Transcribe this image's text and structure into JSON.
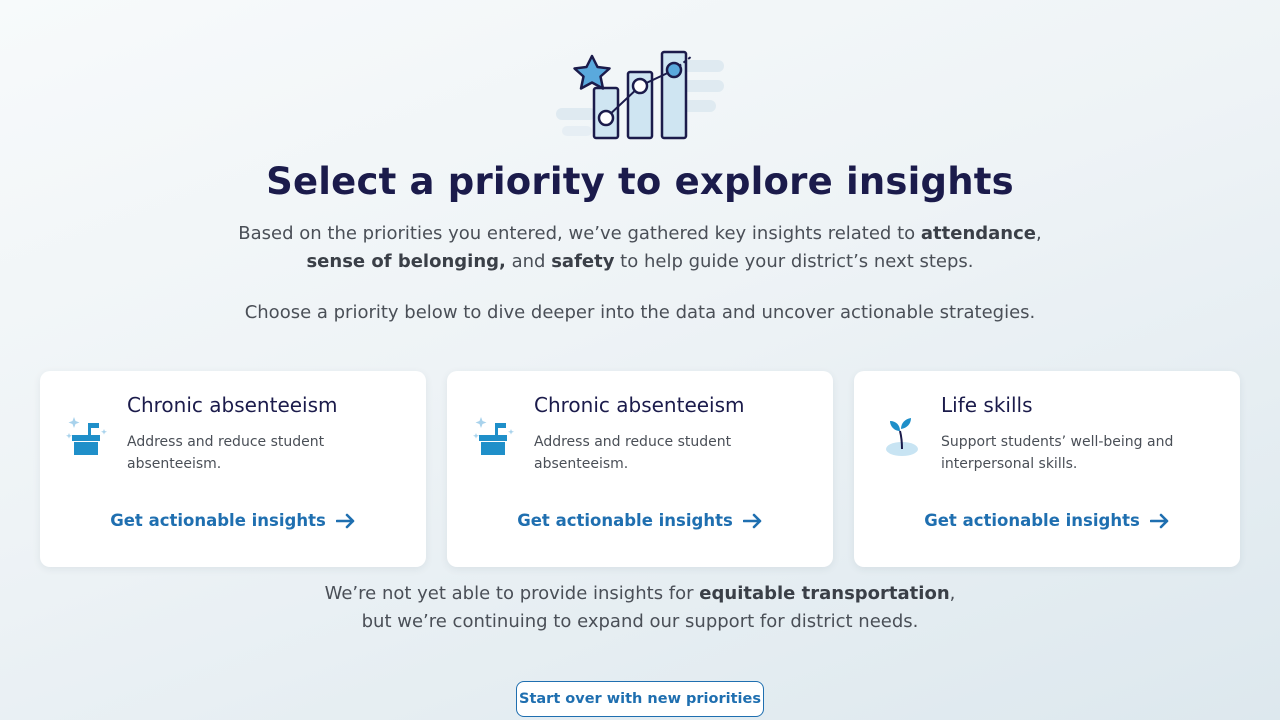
{
  "header": {
    "title": "Select a priority to explore insights",
    "intro_part1": "Based on the priorities you entered, we’ve gathered key insights related to ",
    "intro_bold1": "attendance",
    "intro_part2": ",",
    "intro_bold2": "sense of belonging,",
    "intro_part3": " and ",
    "intro_bold3": "safety",
    "intro_part4": " to help guide your district’s next steps.",
    "choose_text": "Choose a priority below to dive deeper into the data and uncover actionable strategies."
  },
  "cards": [
    {
      "title": "Chronic absenteeism",
      "description": "Address and reduce student absenteeism.",
      "link_label": "Get actionable insights",
      "icon": "mailbox-icon"
    },
    {
      "title": "Chronic absenteeism",
      "description": "Address and reduce student absenteeism.",
      "link_label": "Get actionable insights",
      "icon": "mailbox-icon"
    },
    {
      "title": "Life skills",
      "description": "Support students’ well-being and interpersonal skills.",
      "link_label": "Get actionable insights",
      "icon": "sprout-icon"
    }
  ],
  "notice": {
    "part1": "We’re not yet able to provide insights for ",
    "bold": "equitable transportation",
    "part2": ",",
    "part3": "but we’re continuing to expand our support for district needs."
  },
  "restart_button": "Start over with new priorities",
  "colors": {
    "title": "#1b1b4b",
    "link": "#1f6fb0",
    "icon_blue": "#1f8fc9",
    "icon_light": "#c8e4f3"
  }
}
